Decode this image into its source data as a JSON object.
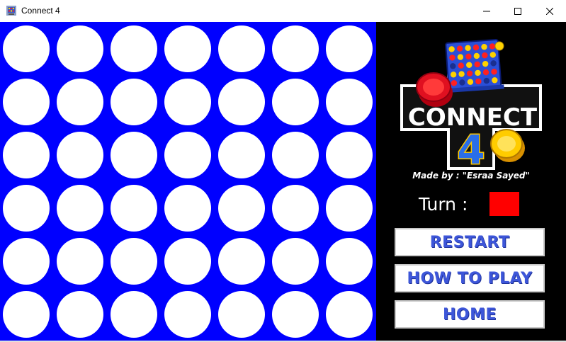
{
  "window": {
    "title": "Connect 4",
    "icon": "connect4-app-icon",
    "controls": [
      "minimize-icon",
      "maximize-icon",
      "close-icon"
    ]
  },
  "board": {
    "rows": 6,
    "columns": 7,
    "background_color": "#0000ff",
    "empty_slot_color": "#ffffff",
    "slots": [
      [
        "empty",
        "empty",
        "empty",
        "empty",
        "empty",
        "empty",
        "empty"
      ],
      [
        "empty",
        "empty",
        "empty",
        "empty",
        "empty",
        "empty",
        "empty"
      ],
      [
        "empty",
        "empty",
        "empty",
        "empty",
        "empty",
        "empty",
        "empty"
      ],
      [
        "empty",
        "empty",
        "empty",
        "empty",
        "empty",
        "empty",
        "empty"
      ],
      [
        "empty",
        "empty",
        "empty",
        "empty",
        "empty",
        "empty",
        "empty"
      ],
      [
        "empty",
        "empty",
        "empty",
        "empty",
        "empty",
        "empty",
        "empty"
      ]
    ]
  },
  "sidebar": {
    "logo": {
      "text": "CONNECT",
      "number": "4",
      "icon": "connect4-logo"
    },
    "credit": "Made by : \"Esraa Sayed\"",
    "turn": {
      "label": "Turn :",
      "color": "#ff0000"
    },
    "buttons": {
      "restart": "RESTART",
      "how_to_play": "HOW TO PLAY",
      "home": "HOME"
    }
  },
  "colors": {
    "sidebar_background": "#000000",
    "button_text": "#3d56d9"
  }
}
